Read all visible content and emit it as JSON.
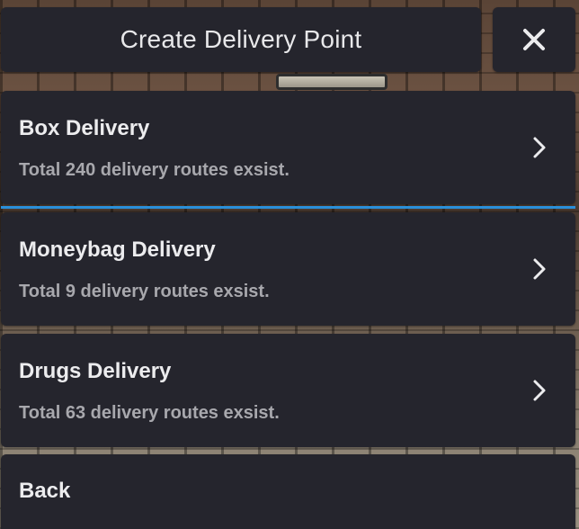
{
  "header": {
    "title": "Create Delivery Point",
    "close_icon": "close-icon"
  },
  "menu": {
    "items": [
      {
        "title": "Box Delivery",
        "subtitle": "Total 240 delivery routes exsist.",
        "icon": "chevron-right-icon"
      },
      {
        "title": "Moneybag Delivery",
        "subtitle": "Total 9 delivery routes exsist.",
        "icon": "chevron-right-icon"
      },
      {
        "title": "Drugs Delivery",
        "subtitle": "Total 63 delivery routes exsist.",
        "icon": "chevron-right-icon"
      }
    ],
    "back_label": "Back"
  },
  "colors": {
    "panel": "#25252d",
    "text": "#ececee",
    "subtext": "#a8a8ad",
    "accent": "#2a8fd9"
  }
}
